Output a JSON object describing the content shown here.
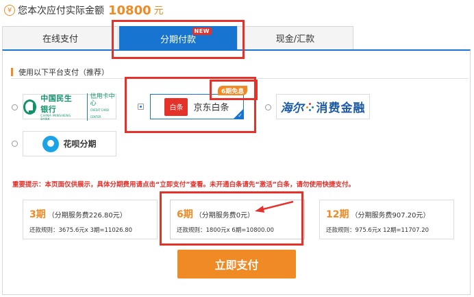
{
  "header": {
    "currency_symbol": "¥",
    "label": "您本次应付实际金额",
    "amount": "10800",
    "unit": "元"
  },
  "tabs": [
    {
      "label": "在线支付",
      "active": false
    },
    {
      "label": "分期付款",
      "active": true,
      "badge": "NEW"
    },
    {
      "label": "现金/汇款",
      "active": false
    }
  ],
  "subtitle": "使用以下平台支付（推荐）",
  "platforms": {
    "cmbc": {
      "name_cn": "中国民生银行",
      "name_en": "CHINA MINSHENG BANK",
      "card_cn": "信用卡中心",
      "card_en": "CREDIT CARD CENTER",
      "selected": false
    },
    "jd": {
      "mark": "白条",
      "name": "京东白条",
      "badge": "6期免息",
      "selected": true
    },
    "haier": {
      "script": "海尔",
      "name": "消费金融",
      "selected": false
    },
    "huabei": {
      "name": "花呗分期",
      "selected": false
    }
  },
  "notice": "重要提示：本页面仅供展示，具体分期费用请点击“立即支付”查看。未开通白条请先“激活”白条，请勿使用快捷支付。",
  "plans": [
    {
      "periods": "3期",
      "fee": "（分期服务费226.80元）",
      "rule": "还款规则：3675.6元x 3期=11026.80"
    },
    {
      "periods": "6期",
      "fee": "（分期服务费0元）",
      "rule": "还款规则：1800元x 6期=10800.00"
    },
    {
      "periods": "12期",
      "fee": "（分期服务费907.20元）",
      "rule": "还款规则：975.6元x 12期=11707.20"
    }
  ],
  "pay_button": "立即支付",
  "colors": {
    "accent": "#f08a24",
    "tab_active": "#1874d1",
    "highlight": "#e4322b",
    "cmbc_green": "#11926a",
    "huabei_blue": "#1ba3e8"
  }
}
